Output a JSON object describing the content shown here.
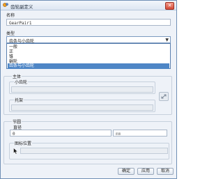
{
  "window": {
    "title": "齿轮副定义",
    "close_label": "✕"
  },
  "name": {
    "label": "名称",
    "value": "GearPair1"
  },
  "type": {
    "label": "类型",
    "selected": "齿条与小齿轮",
    "options": [
      "一般",
      "正",
      "锥",
      "蜗轮",
      "齿条与小齿轮"
    ],
    "highlighted_index": 4
  },
  "body": {
    "label": "主体",
    "pinion_label": "小齿轮",
    "rack_label": "托架"
  },
  "pitch": {
    "label": "节圆",
    "diameter_label": "直径",
    "diameter_value": "0",
    "unit": "mm"
  },
  "icon_pos": {
    "label": "图标位置"
  },
  "buttons": {
    "ok": "确定",
    "apply": "应用",
    "cancel": "取消"
  },
  "colors": {
    "title_gradient": "#dde6f2",
    "highlight": "#4e86c6",
    "close_button": "#d24a37"
  }
}
